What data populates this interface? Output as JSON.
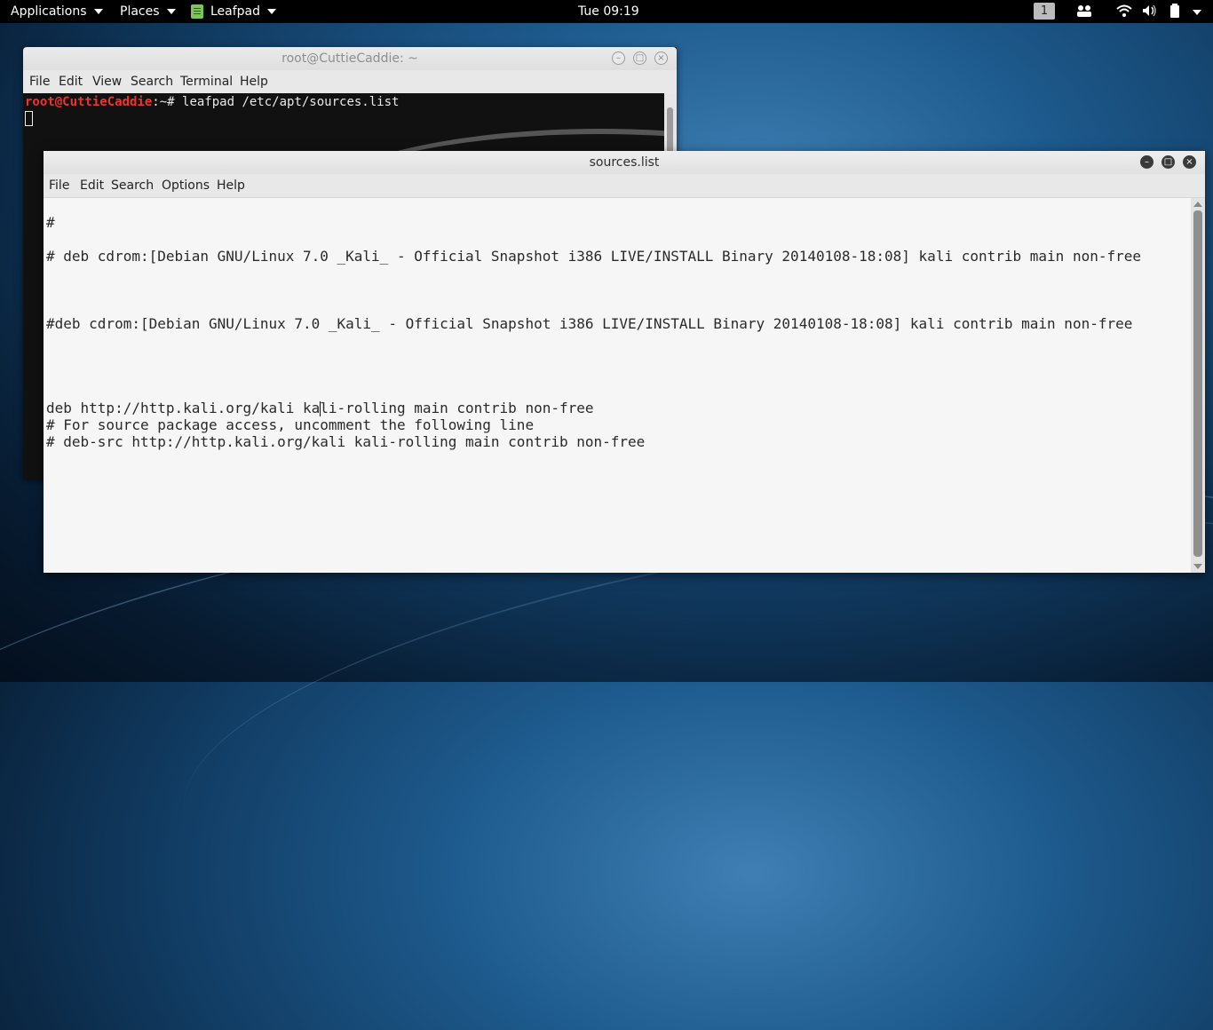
{
  "topbar": {
    "applications": "Applications",
    "places": "Places",
    "app_name": "Leafpad",
    "clock": "Tue 09:19",
    "workspace": "1"
  },
  "terminal": {
    "title": "root@CuttieCaddie: ~",
    "menu": [
      "File",
      "Edit",
      "View",
      "Search",
      "Terminal",
      "Help"
    ],
    "prompt_user": "root@CuttieCaddie",
    "prompt_rest": ":~# leafpad /etc/apt/sources.list"
  },
  "leafpad": {
    "title": "sources.list",
    "menu": [
      "File",
      "Edit",
      "Search",
      "Options",
      "Help"
    ],
    "lines": [
      "#",
      "# deb cdrom:[Debian GNU/Linux 7.0 _Kali_ - Official Snapshot i386 LIVE/INSTALL Binary 20140108-18:08] kali contrib main non-free",
      "#deb cdrom:[Debian GNU/Linux 7.0 _Kali_ - Official Snapshot i386 LIVE/INSTALL Binary 20140108-18:08] kali contrib main non-free",
      "deb http://http.kali.org/kali ka",
      "li-rolling main contrib non-free",
      "# For source package access, uncomment the following line",
      "# deb-src http://http.kali.org/kali kali-rolling main contrib non-free"
    ]
  },
  "colors": {
    "prompt_user": "#ee3333",
    "panel": "#000000"
  }
}
